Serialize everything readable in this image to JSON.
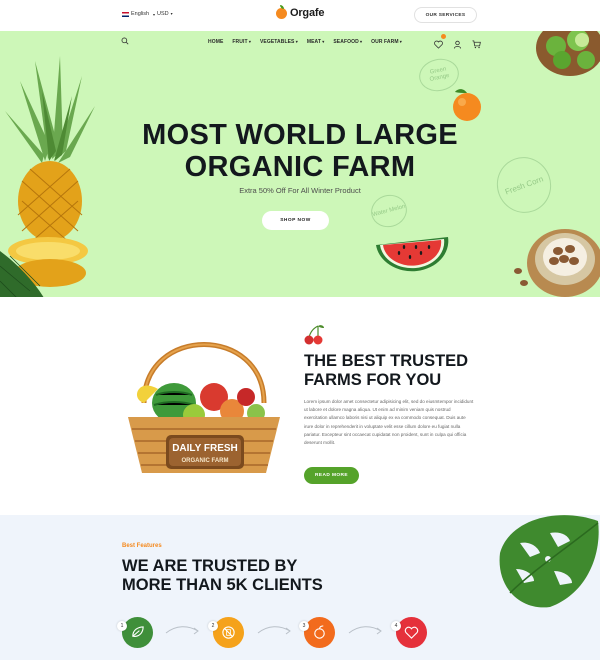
{
  "topbar": {
    "language": "English",
    "currency": "USD",
    "logo": "Orgafe",
    "services_button": "OUR SERVICES"
  },
  "nav": {
    "items": [
      "HOME",
      "FRUIT",
      "VEGETABLES",
      "MEAT",
      "SEAFOOD",
      "OUR FARM"
    ]
  },
  "hero": {
    "title_line1": "MOST WORLD LARGE",
    "title_line2": "ORGANIC FARM",
    "subtitle": "Extra 50% Off For All Winter Product",
    "button": "SHOP NOW",
    "bubbles": [
      "Green Orange",
      "Water Melon",
      "Fresh Corn"
    ]
  },
  "about": {
    "title_line1": "THE BEST TRUSTED",
    "title_line2": "FARMS FOR YOU",
    "body": "Lorem ipsum dolor amet consectetur adipisicing elit, sed do eiusmtempor incididunt ut labore et dolore magna aliqua. Ut enim ad minim veniam quis nostrud exercitation ullamco laboris nisi ut aliquip ex ea commodo consequat. Duis aute irure dolor in reprehenderit in voluptate velit esse cillum dolore eu fugiat nulla pariatur. Excepteur sint occaecat cupidatat non proident, sunt in culpa qui officia deserunt mollit.",
    "button": "READ MORE",
    "basket_sign_line1": "DAILY FRESH",
    "basket_sign_line2": "ORGANIC FARM"
  },
  "trusted": {
    "label": "Best Features",
    "title_line1": "WE ARE TRUSTED BY",
    "title_line2": "MORE THAN 5K CLIENTS",
    "steps": [
      {
        "num": "1",
        "color": "#3f8f3a",
        "icon": "leaf-icon"
      },
      {
        "num": "2",
        "color": "#f5a21b",
        "icon": "no-chemical-icon"
      },
      {
        "num": "3",
        "color": "#f26b1d",
        "icon": "fruit-icon"
      },
      {
        "num": "4",
        "color": "#e5313b",
        "icon": "heart-icon"
      }
    ]
  },
  "colors": {
    "hero_bg": "#cdf7b8",
    "accent_green": "#55a32a",
    "accent_orange": "#f58a1f",
    "features_bg": "#eff4fb"
  }
}
